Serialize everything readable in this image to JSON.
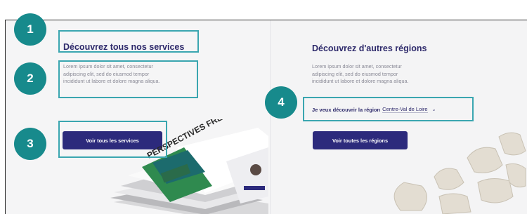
{
  "left_panel": {
    "title": "Découvrez tous nos services",
    "body": "Lorem ipsum dolor sit amet, consectetur\nadipiscing elit, sed do eiusmod tempor\nincididunt ut labore et dolore magna aliqua.",
    "button_label": "Voir tous les services",
    "magazine_title": "PERSPECTIVES FRET"
  },
  "right_panel": {
    "title": "Découvrez d'autres régions",
    "body": "Lorem ipsum dolor sit amet, consectetur\nadipiscing elit, sed do eiusmod tempor\nincididunt ut labore et dolore magna aliqua.",
    "region_prompt": "Je veux découvrir la région",
    "region_selected": "Centre-Val de Loire",
    "button_label": "Voir toutes les régions"
  },
  "markers": [
    "1",
    "2",
    "3",
    "4"
  ],
  "colors": {
    "primary": "#2c2a7c",
    "marker": "#178a8c",
    "highlight": "#3aa6b0"
  }
}
